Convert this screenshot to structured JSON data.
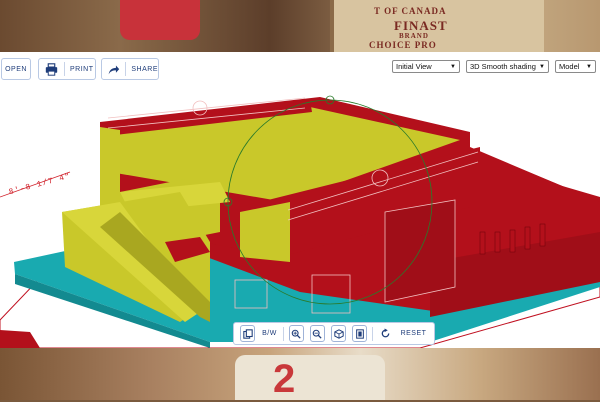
{
  "background": {
    "crate_lines": [
      "T OF CANADA",
      "FINAST",
      "BRAND",
      "CHOICE PRO"
    ],
    "sign_text": "2"
  },
  "toolbar": {
    "open_label": "OPEN",
    "print_label": "PRINT",
    "share_label": "SHARE"
  },
  "view_controls": {
    "camera": "Initial View",
    "shading": "3D Smooth shading",
    "mode": "Model"
  },
  "dimension": {
    "label": "8'-8 1/7 4\""
  },
  "bottom_toolbar": {
    "bw_label": "B/W",
    "reset_label": "RESET"
  },
  "colors": {
    "model_red": "#b3101b",
    "model_yellow": "#c9c82a",
    "model_teal": "#19aab0",
    "accent_blue": "#1f3d7a"
  },
  "icons": [
    "open-icon",
    "print-icon",
    "share-icon",
    "chevron-down-icon",
    "copy-view-icon",
    "zoom-in-icon",
    "zoom-out-icon",
    "cube-icon",
    "page-icon",
    "rotate-reset-icon"
  ]
}
